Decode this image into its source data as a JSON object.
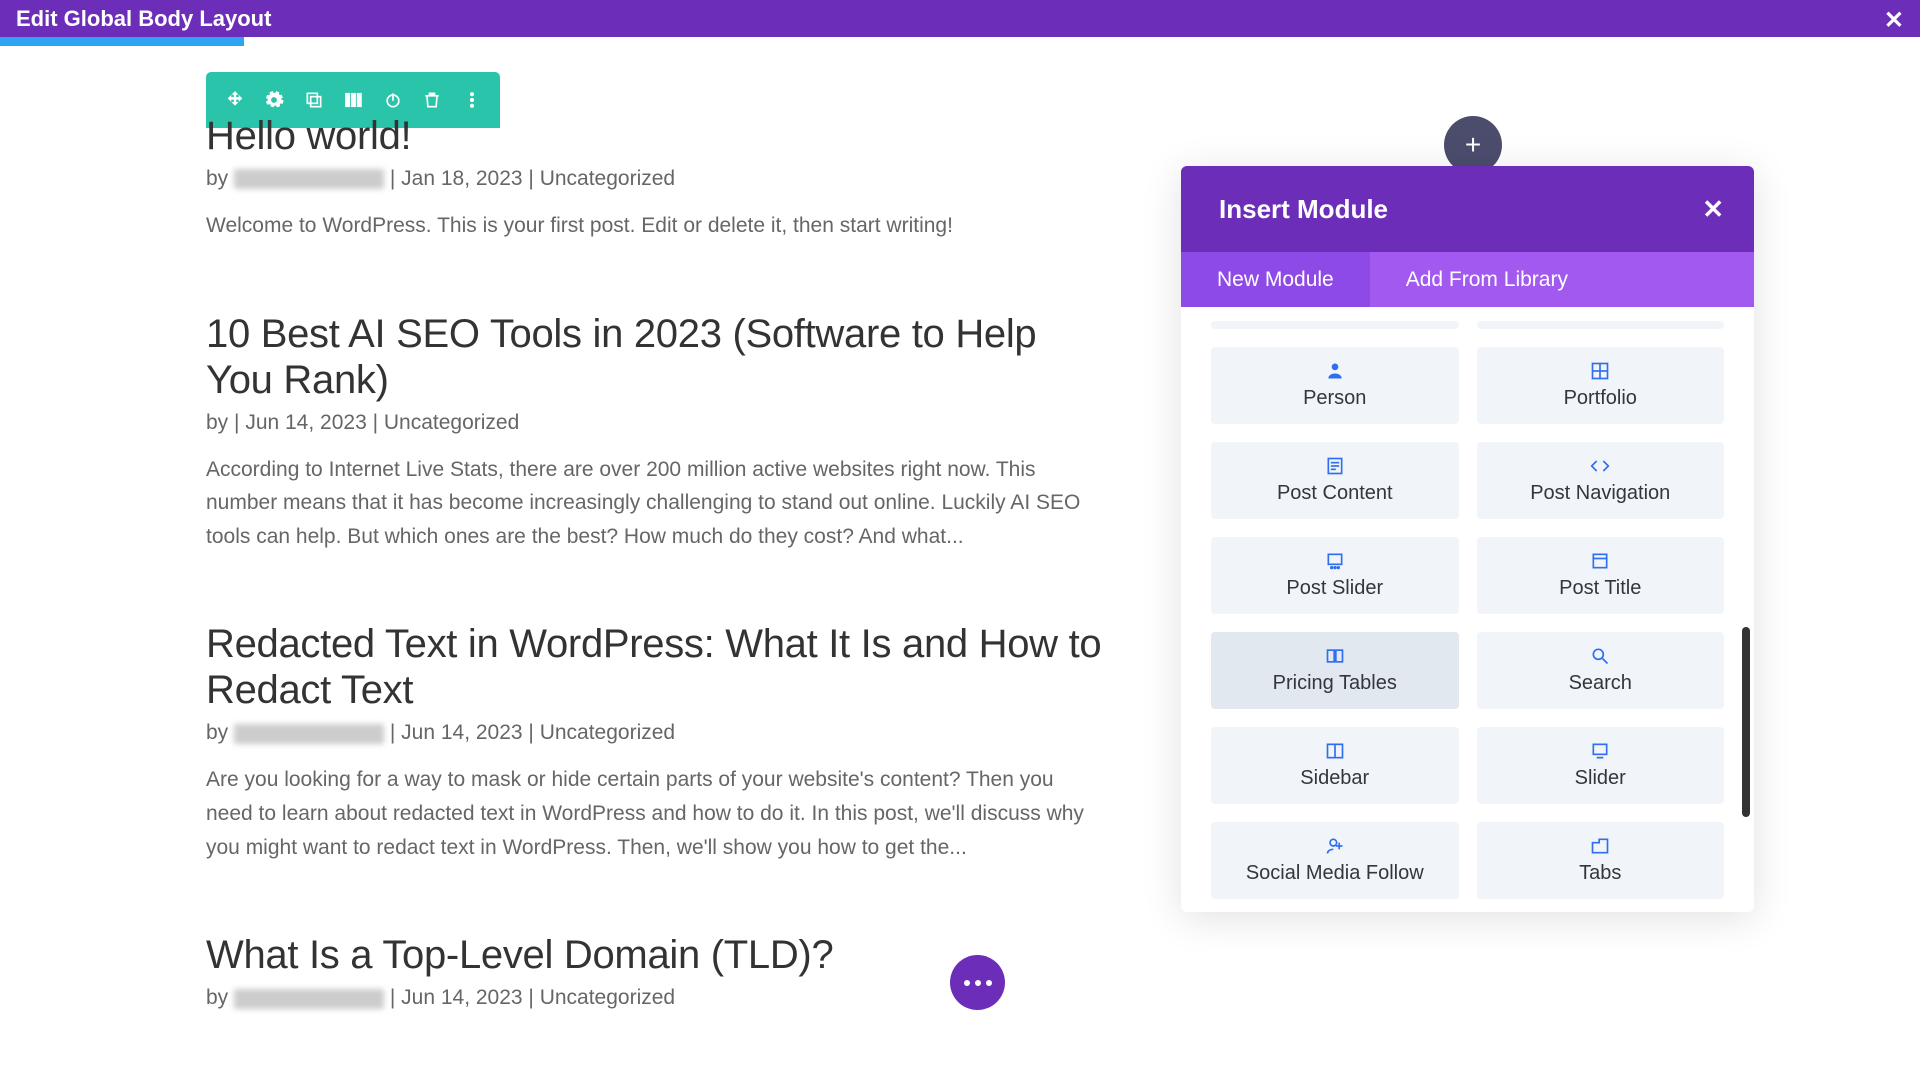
{
  "topbar": {
    "title": "Edit Global Body Layout"
  },
  "posts": [
    {
      "title": "Hello world!",
      "by": "by ",
      "author_redacted": true,
      "sep": " | ",
      "date": "Jan 18, 2023",
      "cat": "Uncategorized",
      "excerpt": "Welcome to WordPress. This is your first post. Edit or delete it, then start writing!"
    },
    {
      "title": "10 Best AI SEO Tools in 2023 (Software to Help You Rank)",
      "by": "by ",
      "author_redacted": false,
      "sep": "| ",
      "date": "Jun 14, 2023",
      "cat": "Uncategorized",
      "excerpt": "According to Internet Live Stats, there are over 200 million active websites right now. This number means that it has become increasingly challenging to stand out online. Luckily AI SEO tools can help. But which ones are the best? How much do they cost? And what..."
    },
    {
      "title": "Redacted Text in WordPress: What It Is and How to Redact Text",
      "by": "by ",
      "author_redacted": true,
      "sep": " | ",
      "date": "Jun 14, 2023",
      "cat": "Uncategorized",
      "excerpt": "Are you looking for a way to mask or hide certain parts of your website's content? Then you need to learn about redacted text in WordPress and how to do it. In this post, we'll discuss why you might want to redact text in WordPress. Then, we'll show you how to get the..."
    },
    {
      "title": "What Is a Top-Level Domain (TLD)?",
      "by": "by ",
      "author_redacted": true,
      "sep": " | ",
      "date": "Jun 14, 2023",
      "cat": "Uncategorized",
      "excerpt": ""
    }
  ],
  "panel": {
    "title": "Insert Module",
    "tabs": {
      "new": "New Module",
      "library": "Add From Library"
    }
  },
  "modules": [
    {
      "icon": "person",
      "label": "Person"
    },
    {
      "icon": "grid",
      "label": "Portfolio"
    },
    {
      "icon": "doc",
      "label": "Post Content"
    },
    {
      "icon": "code",
      "label": "Post Navigation"
    },
    {
      "icon": "slider-post",
      "label": "Post Slider"
    },
    {
      "icon": "title",
      "label": "Post Title"
    },
    {
      "icon": "tables",
      "label": "Pricing Tables",
      "hover": true
    },
    {
      "icon": "search",
      "label": "Search"
    },
    {
      "icon": "sidebar",
      "label": "Sidebar"
    },
    {
      "icon": "slider",
      "label": "Slider"
    },
    {
      "icon": "follow",
      "label": "Social Media Follow"
    },
    {
      "icon": "tabs",
      "label": "Tabs"
    }
  ]
}
